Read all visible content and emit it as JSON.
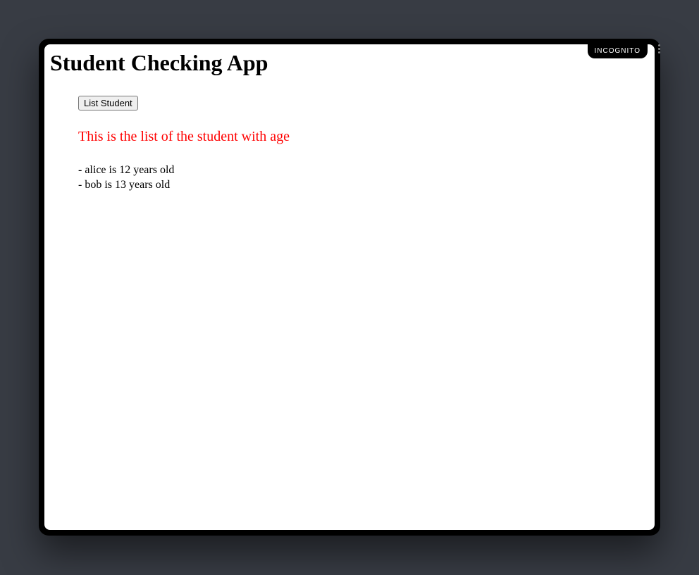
{
  "window": {
    "badge": "INCOGNITO"
  },
  "page": {
    "title": "Student Checking App",
    "list_button_label": "List Student",
    "subheading": "This is the list of the student with age",
    "students": [
      {
        "line": "- alice is 12 years old"
      },
      {
        "line": "- bob is 13 years old"
      }
    ]
  }
}
